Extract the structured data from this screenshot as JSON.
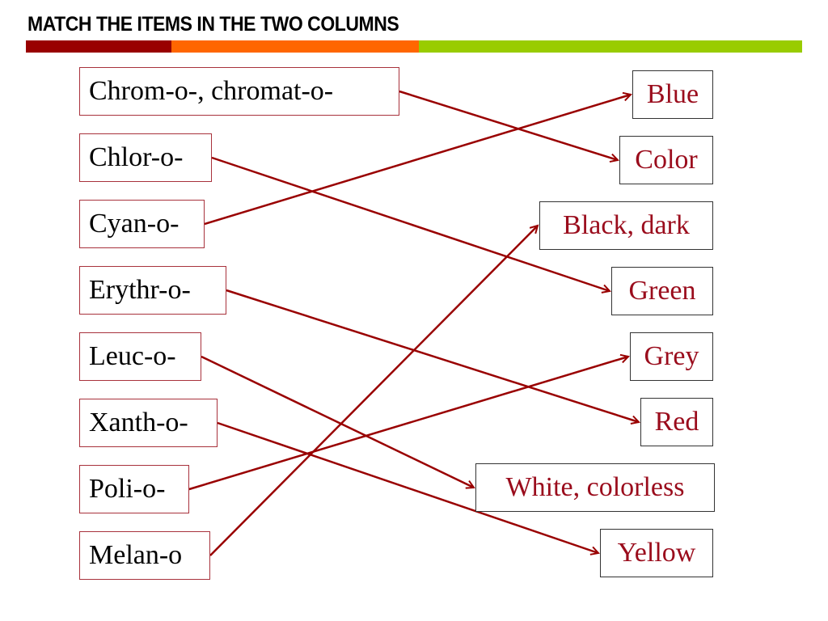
{
  "title": "MATCH THE ITEMS IN THE TWO COLUMNS",
  "colors": {
    "bar1": "#990000",
    "bar2": "#ff6600",
    "bar3": "#99cc00",
    "arrow": "#990000",
    "answer_text": "#9a0c1c"
  },
  "left_items": [
    "Chrom-o-, chromat-o-",
    "Chlor-o-",
    "Cyan-o-",
    "Erythr-o-",
    "Leuc-o-",
    "Xanth-o-",
    "Poli-o-",
    "Melan-o"
  ],
  "right_items": [
    "Blue",
    "Color",
    "Black, dark",
    "Green",
    "Grey",
    "Red",
    "White, colorless",
    "Yellow"
  ],
  "matches": [
    {
      "from": "Chrom-o-, chromat-o-",
      "to": "Color"
    },
    {
      "from": "Chlor-o-",
      "to": "Green"
    },
    {
      "from": "Cyan-o-",
      "to": "Blue"
    },
    {
      "from": "Erythr-o-",
      "to": "Red"
    },
    {
      "from": "Leuc-o-",
      "to": "White, colorless"
    },
    {
      "from": "Xanth-o-",
      "to": "Yellow"
    },
    {
      "from": "Poli-o-",
      "to": "Grey"
    },
    {
      "from": "Melan-o",
      "to": "Black, dark"
    }
  ]
}
